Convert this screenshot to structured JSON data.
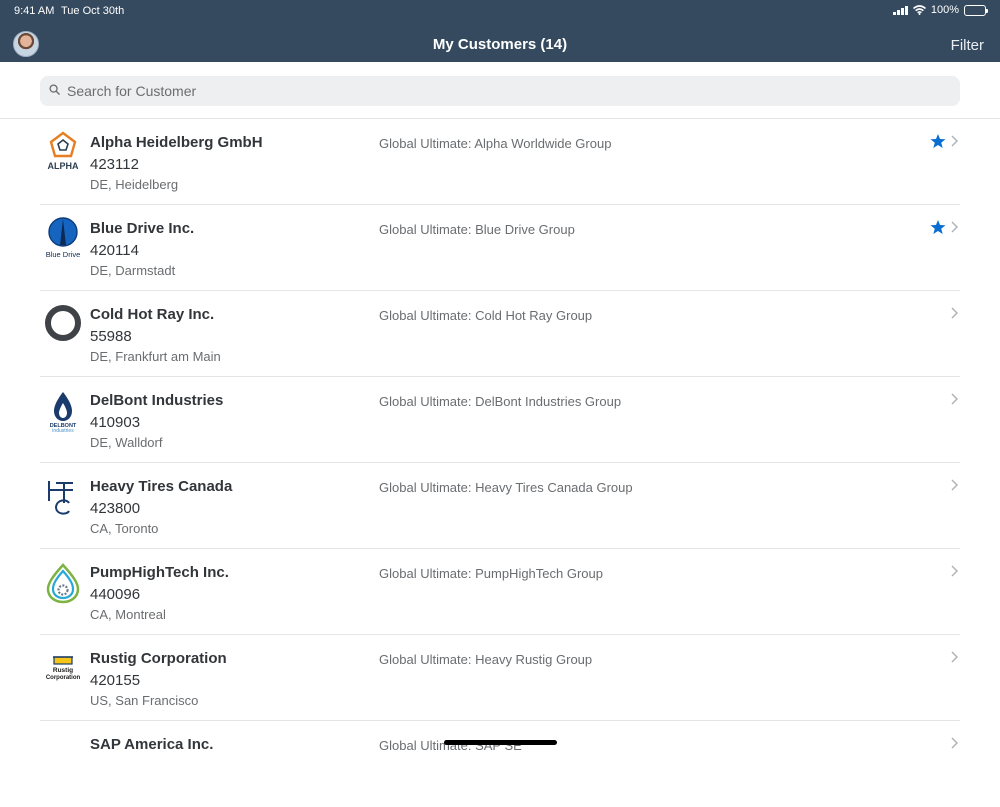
{
  "status_bar": {
    "time": "9:41 AM",
    "date": "Tue Oct 30th",
    "battery": "100%"
  },
  "header": {
    "title": "My Customers (14)",
    "filter_label": "Filter"
  },
  "search": {
    "placeholder": "Search for Customer",
    "value": ""
  },
  "logo_text": {
    "alpha": "ALPHA",
    "blue_drive": "Blue Drive",
    "delbont_top": "DELBONT",
    "delbont_bottom": "industries",
    "rustig_1": "Rustig",
    "rustig_2": "Corporation"
  },
  "colors": {
    "header_bg": "#354a5f",
    "accent": "#0a6ed1"
  },
  "customers": [
    {
      "name": "Alpha Heidelberg GmbH",
      "id": "423112",
      "location": "DE, Heidelberg",
      "global_ultimate": "Global Ultimate: Alpha Worldwide Group",
      "favorite": true,
      "logo": "alpha-logo"
    },
    {
      "name": "Blue Drive Inc.",
      "id": "420114",
      "location": "DE, Darmstadt",
      "global_ultimate": "Global Ultimate: Blue Drive Group",
      "favorite": true,
      "logo": "blue-drive-logo"
    },
    {
      "name": "Cold Hot Ray Inc.",
      "id": "55988",
      "location": "DE, Frankfurt am Main",
      "global_ultimate": "Global Ultimate: Cold Hot Ray Group",
      "favorite": false,
      "logo": "cold-hot-ray-logo"
    },
    {
      "name": "DelBont Industries",
      "id": "410903",
      "location": "DE, Walldorf",
      "global_ultimate": "Global Ultimate: DelBont Industries Group",
      "favorite": false,
      "logo": "delbont-logo"
    },
    {
      "name": "Heavy Tires Canada",
      "id": "423800",
      "location": "CA, Toronto",
      "global_ultimate": "Global Ultimate: Heavy Tires Canada Group",
      "favorite": false,
      "logo": "heavy-tires-logo"
    },
    {
      "name": "PumpHighTech Inc.",
      "id": "440096",
      "location": "CA, Montreal",
      "global_ultimate": "Global Ultimate: PumpHighTech Group",
      "favorite": false,
      "logo": "pumphightech-logo"
    },
    {
      "name": "Rustig Corporation",
      "id": "420155",
      "location": "US, San Francisco",
      "global_ultimate": "Global Ultimate: Heavy Rustig Group",
      "favorite": false,
      "logo": "rustig-logo"
    },
    {
      "name": "SAP America Inc.",
      "id": "",
      "location": "",
      "global_ultimate": "Global Ultimate: SAP SE",
      "favorite": false,
      "logo": ""
    }
  ]
}
